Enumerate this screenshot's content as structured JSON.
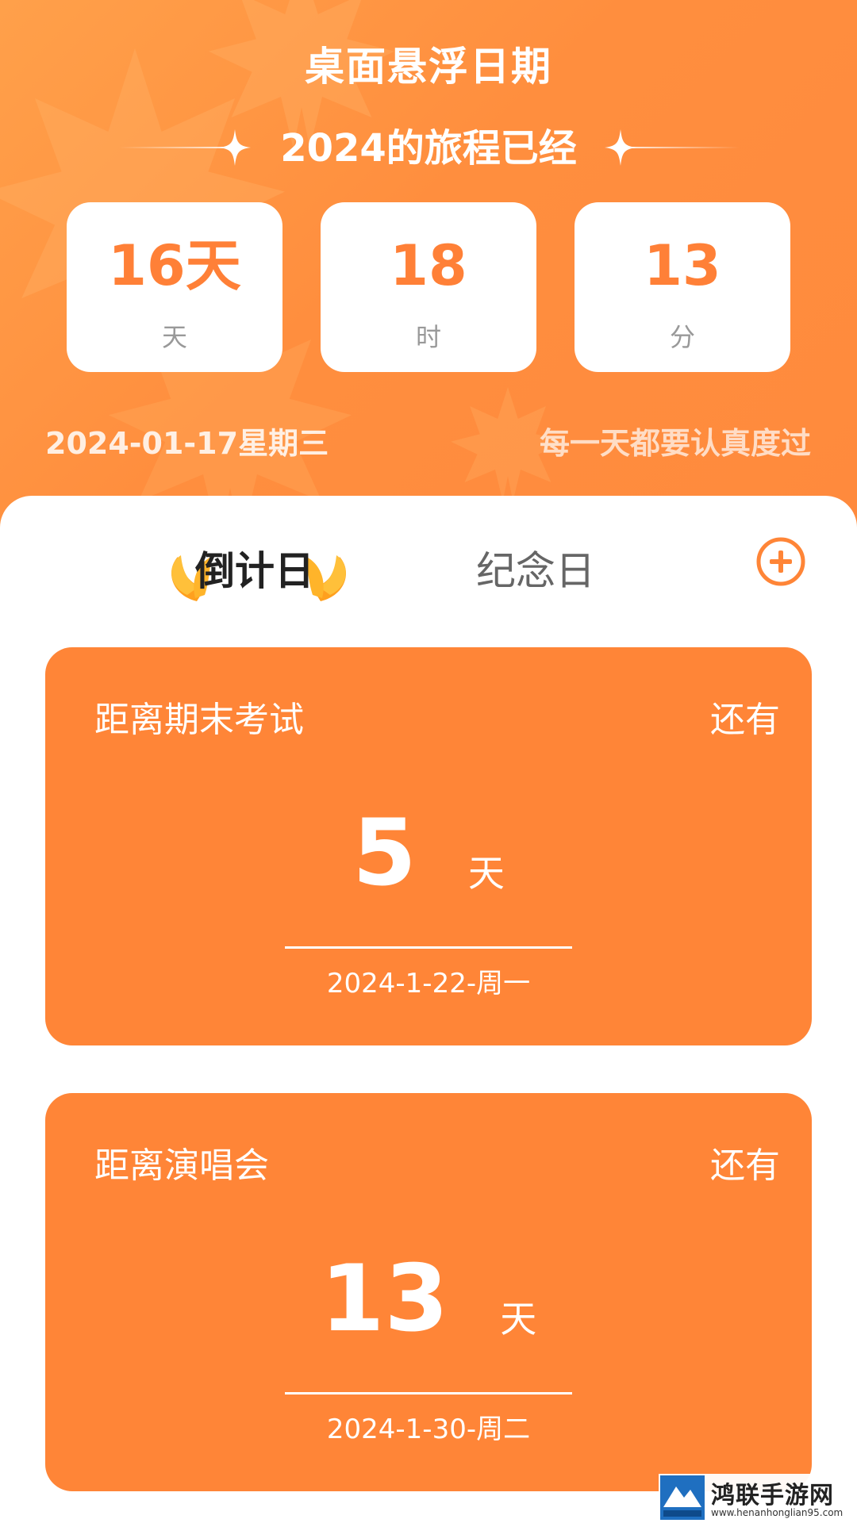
{
  "header": {
    "title": "桌面悬浮日期",
    "journey_text": "2024的旅程已经",
    "stats": [
      {
        "value": "16天",
        "unit": "天"
      },
      {
        "value": "18",
        "unit": "时"
      },
      {
        "value": "13",
        "unit": "分"
      }
    ],
    "today": "2024-01-17星期三",
    "motto": "每一天都要认真度过"
  },
  "tabs": {
    "active_label": "倒计日",
    "inactive_label": "纪念日"
  },
  "cards": [
    {
      "title": "距离期末考试",
      "remain_label": "还有",
      "days": "5",
      "unit": "天",
      "date": "2024-1-22-周一"
    },
    {
      "title": "距离演唱会",
      "remain_label": "还有",
      "days": "13",
      "unit": "天",
      "date": "2024-1-30-周二"
    }
  ],
  "watermark": {
    "title": "鸿联手游网",
    "url": "www.henanhonglian95.com"
  },
  "colors": {
    "accent": "#ff8537",
    "hero": "#ff8e3e",
    "stat_value": "#ff8037"
  },
  "icons": {
    "add": "add-circle-icon",
    "sparkle": "sparkle-icon",
    "laurel": "laurel-icon"
  }
}
